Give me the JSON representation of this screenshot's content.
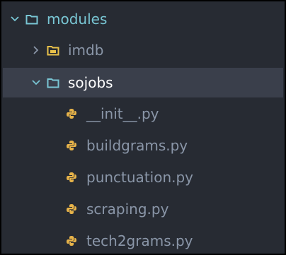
{
  "tree": {
    "modules": {
      "label": "modules",
      "expanded": true
    },
    "imdb": {
      "label": "imdb",
      "expanded": false
    },
    "sojobs": {
      "label": "sojobs",
      "expanded": true,
      "selected": true
    },
    "files": [
      {
        "label": "__init__.py",
        "icon": "python-icon"
      },
      {
        "label": "buildgrams.py",
        "icon": "python-icon"
      },
      {
        "label": "punctuation.py",
        "icon": "python-icon"
      },
      {
        "label": "scraping.py",
        "icon": "python-icon"
      },
      {
        "label": "tech2grams.py",
        "icon": "python-icon"
      }
    ]
  },
  "colors": {
    "background": "#272b33",
    "selected_row": "#3a3f4b",
    "folder_teal": "#79c6d4",
    "folder_yellow": "#e8c14a",
    "selected_text": "#ffffff",
    "file_text": "#8a96a8",
    "python_icon": "#e8b44a"
  }
}
